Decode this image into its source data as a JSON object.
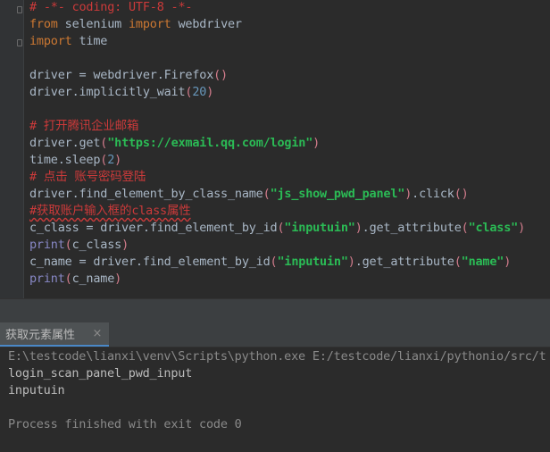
{
  "editor": {
    "lines": [
      {
        "parts": [
          {
            "t": "# -*- coding: UTF-8 -*-",
            "c": "cm"
          }
        ]
      },
      {
        "parts": [
          {
            "t": "from",
            "c": "kw"
          },
          {
            "t": " selenium ",
            "c": ""
          },
          {
            "t": "import",
            "c": "kw"
          },
          {
            "t": " webdriver",
            "c": ""
          }
        ]
      },
      {
        "parts": [
          {
            "t": "import",
            "c": "kw"
          },
          {
            "t": " time",
            "c": ""
          }
        ]
      },
      {
        "parts": []
      },
      {
        "parts": [
          {
            "t": "driver = webdriver.Firefox",
            "c": ""
          },
          {
            "t": "()",
            "c": "pink"
          }
        ]
      },
      {
        "parts": [
          {
            "t": "driver.implicitly_wait",
            "c": ""
          },
          {
            "t": "(",
            "c": "pink"
          },
          {
            "t": "20",
            "c": "num"
          },
          {
            "t": ")",
            "c": "pink"
          }
        ]
      },
      {
        "parts": []
      },
      {
        "parts": [
          {
            "t": "# 打开腾讯企业邮箱",
            "c": "cm"
          }
        ]
      },
      {
        "parts": [
          {
            "t": "driver.get",
            "c": ""
          },
          {
            "t": "(",
            "c": "pink"
          },
          {
            "t": "\"https://exmail.qq.com/login\"",
            "c": "strg"
          },
          {
            "t": ")",
            "c": "pink"
          }
        ]
      },
      {
        "parts": [
          {
            "t": "time.sleep",
            "c": ""
          },
          {
            "t": "(",
            "c": "pink"
          },
          {
            "t": "2",
            "c": "num"
          },
          {
            "t": ")",
            "c": "pink"
          }
        ]
      },
      {
        "parts": [
          {
            "t": "# 点击 账号密码登陆",
            "c": "cm"
          }
        ]
      },
      {
        "parts": [
          {
            "t": "driver.find_element_by_class_name",
            "c": ""
          },
          {
            "t": "(",
            "c": "pink"
          },
          {
            "t": "\"js_show_pwd_panel\"",
            "c": "strg"
          },
          {
            "t": ")",
            "c": "pink"
          },
          {
            "t": ".click",
            "c": ""
          },
          {
            "t": "()",
            "c": "pink"
          }
        ]
      },
      {
        "parts": [
          {
            "t": "#获取账户输入框的class属性",
            "c": "cm-u"
          }
        ]
      },
      {
        "parts": [
          {
            "t": "c_class = driver.find_element_by_id",
            "c": ""
          },
          {
            "t": "(",
            "c": "pink"
          },
          {
            "t": "\"inputuin\"",
            "c": "strg"
          },
          {
            "t": ")",
            "c": "pink"
          },
          {
            "t": ".get_attribute",
            "c": ""
          },
          {
            "t": "(",
            "c": "pink"
          },
          {
            "t": "\"class\"",
            "c": "strg"
          },
          {
            "t": ")",
            "c": "pink"
          }
        ]
      },
      {
        "parts": [
          {
            "t": "print",
            "c": "bi"
          },
          {
            "t": "(",
            "c": "pink"
          },
          {
            "t": "c_class",
            "c": ""
          },
          {
            "t": ")",
            "c": "pink"
          }
        ]
      },
      {
        "parts": [
          {
            "t": "c_name = driver.find_element_by_id",
            "c": ""
          },
          {
            "t": "(",
            "c": "pink"
          },
          {
            "t": "\"inputuin\"",
            "c": "strg"
          },
          {
            "t": ")",
            "c": "pink"
          },
          {
            "t": ".get_attribute",
            "c": ""
          },
          {
            "t": "(",
            "c": "pink"
          },
          {
            "t": "\"name\"",
            "c": "strg"
          },
          {
            "t": ")",
            "c": "pink"
          }
        ]
      },
      {
        "parts": [
          {
            "t": "print",
            "c": "bi"
          },
          {
            "t": "(",
            "c": "pink"
          },
          {
            "t": "c_name",
            "c": ""
          },
          {
            "t": ")",
            "c": "pink"
          }
        ]
      }
    ]
  },
  "run_panel": {
    "tab_label": "获取元素属性",
    "close_symbol": "×",
    "output": [
      "E:\\testcode\\lianxi\\venv\\Scripts\\python.exe E:/testcode/lianxi/pythonio/src/t",
      "login_scan_panel_pwd_input",
      "inputuin",
      "",
      "Process finished with exit code 0"
    ]
  },
  "colors": {
    "background": "#2b2b2b",
    "keyword": "#cc7832",
    "comment": "#cc3a3a",
    "string": "#2bbb55",
    "number": "#6897bb",
    "builtin": "#8888c6"
  }
}
